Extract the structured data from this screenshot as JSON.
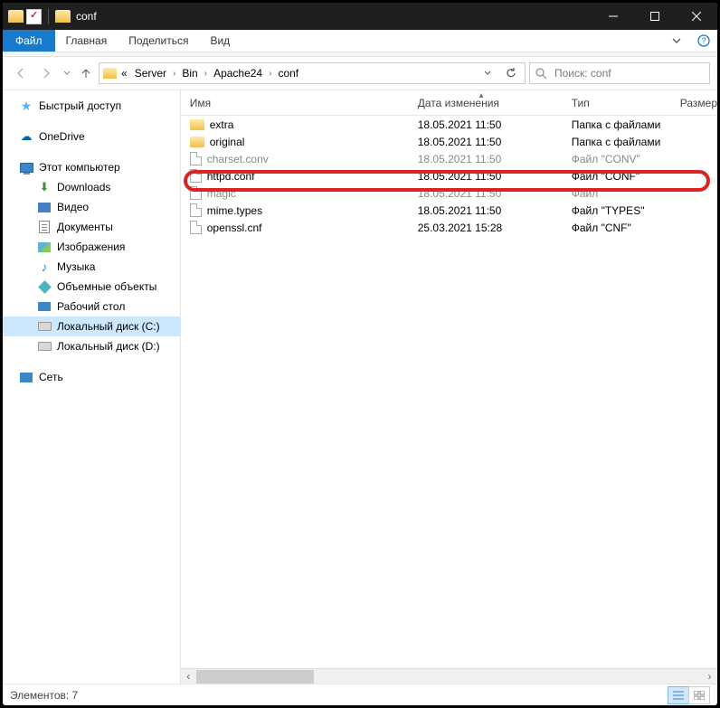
{
  "window": {
    "title": "conf"
  },
  "menu": {
    "file": "Файл",
    "home": "Главная",
    "share": "Поделиться",
    "view": "Вид"
  },
  "breadcrumb": {
    "sep": "«",
    "p1": "Server",
    "p2": "Bin",
    "p3": "Apache24",
    "p4": "conf"
  },
  "search": {
    "placeholder": "Поиск: conf"
  },
  "sidebar": {
    "quick": "Быстрый доступ",
    "onedrive": "OneDrive",
    "pc": "Этот компьютер",
    "downloads": "Downloads",
    "video": "Видео",
    "documents": "Документы",
    "pictures": "Изображения",
    "music": "Музыка",
    "objects3d": "Объемные объекты",
    "desktop": "Рабочий стол",
    "diskc": "Локальный диск (C:)",
    "diskd": "Локальный диск (D:)",
    "network": "Сеть"
  },
  "columns": {
    "name": "Имя",
    "date": "Дата изменения",
    "type": "Тип",
    "size": "Размер"
  },
  "files": [
    {
      "name": "extra",
      "date": "18.05.2021 11:50",
      "type": "Папка с файлами",
      "kind": "folder"
    },
    {
      "name": "original",
      "date": "18.05.2021 11:50",
      "type": "Папка с файлами",
      "kind": "folder"
    },
    {
      "name": "charset.conv",
      "date": "18.05.2021 11:50",
      "type": "Файл \"CONV\"",
      "kind": "file",
      "dim": true
    },
    {
      "name": "httpd.conf",
      "date": "18.05.2021 11:50",
      "type": "Файл \"CONF\"",
      "kind": "file"
    },
    {
      "name": "magic",
      "date": "18.05.2021 11:50",
      "type": "Файл",
      "kind": "file",
      "dim": true
    },
    {
      "name": "mime.types",
      "date": "18.05.2021 11:50",
      "type": "Файл \"TYPES\"",
      "kind": "file"
    },
    {
      "name": "openssl.cnf",
      "date": "25.03.2021 15:28",
      "type": "Файл \"CNF\"",
      "kind": "file"
    }
  ],
  "status": {
    "count": "Элементов: 7"
  }
}
